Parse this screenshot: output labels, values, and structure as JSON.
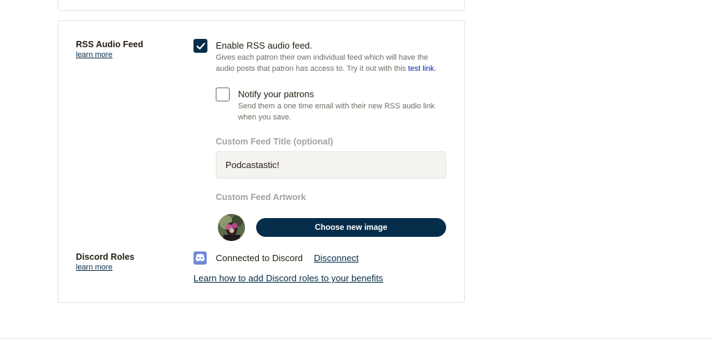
{
  "rss": {
    "title": "RSS Audio Feed",
    "learn_more": "learn more",
    "enable_label": "Enable RSS audio feed.",
    "enable_checked": true,
    "enable_desc_line1": "Gives each patron their own individual feed which will have the",
    "enable_desc_line2": "audio posts that patron has access to. Try it out with this",
    "test_link": "test link.",
    "notify_label": "Notify your patrons",
    "notify_checked": false,
    "notify_desc_line1": "Send them a one time email with their new RSS audio link",
    "notify_desc_line2": "when you save.",
    "custom_title_label": "Custom Feed Title (optional)",
    "custom_title_value": "Podcastastic!",
    "artwork_label": "Custom Feed Artwork",
    "choose_image_button": "Choose new image"
  },
  "discord": {
    "title": "Discord Roles",
    "learn_more": "learn more",
    "icon": "discord-icon",
    "status": "Connected to Discord",
    "disconnect": "Disconnect",
    "help_link": "Learn how to add Discord roles to your benefits"
  },
  "colors": {
    "primary": "#052d49",
    "discord": "#7289da",
    "link_blue": "#0b1fb5",
    "muted": "#706c64"
  }
}
